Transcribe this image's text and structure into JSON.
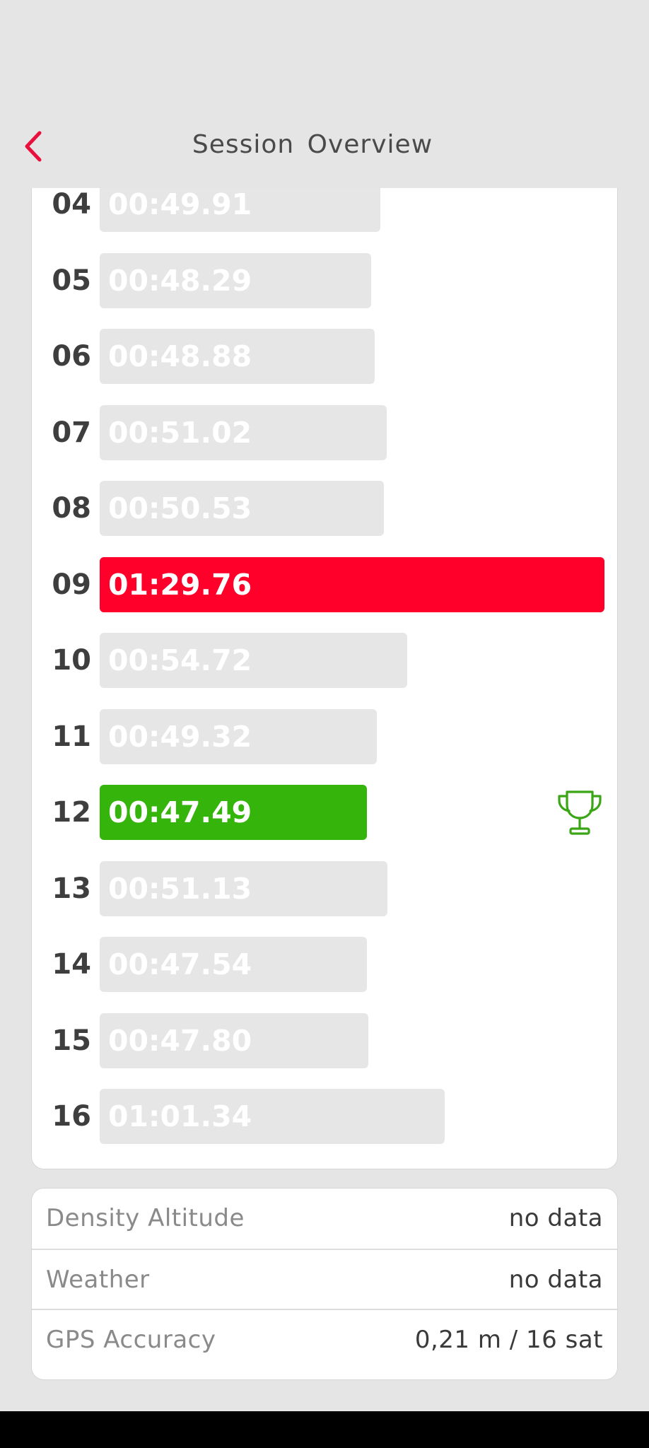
{
  "header": {
    "title": "Session  Overview",
    "back_icon": "chevron-left-icon",
    "accent_color": "#e8103c"
  },
  "laps": [
    {
      "number": "04",
      "time": "00:49.91",
      "status": "normal"
    },
    {
      "number": "05",
      "time": "00:48.29",
      "status": "normal"
    },
    {
      "number": "06",
      "time": "00:48.88",
      "status": "normal"
    },
    {
      "number": "07",
      "time": "00:51.02",
      "status": "normal"
    },
    {
      "number": "08",
      "time": "00:50.53",
      "status": "normal"
    },
    {
      "number": "09",
      "time": "01:29.76",
      "status": "slowest"
    },
    {
      "number": "10",
      "time": "00:54.72",
      "status": "normal"
    },
    {
      "number": "11",
      "time": "00:49.32",
      "status": "normal"
    },
    {
      "number": "12",
      "time": "00:47.49",
      "status": "best",
      "icon": "trophy-icon"
    },
    {
      "number": "13",
      "time": "00:51.13",
      "status": "normal"
    },
    {
      "number": "14",
      "time": "00:47.54",
      "status": "normal"
    },
    {
      "number": "15",
      "time": "00:47.80",
      "status": "normal"
    },
    {
      "number": "16",
      "time": "01:01.34",
      "status": "normal"
    }
  ],
  "colors": {
    "normal_bar": "#e6e6e6",
    "slowest_bar": "#ff002b",
    "best_bar": "#35b50c",
    "trophy": "#3aa515"
  },
  "info": [
    {
      "label": "Density Altitude",
      "value": "no data"
    },
    {
      "label": "Weather",
      "value": "no data"
    },
    {
      "label": "GPS Accuracy",
      "value": "0,21 m / 16 sat"
    }
  ]
}
